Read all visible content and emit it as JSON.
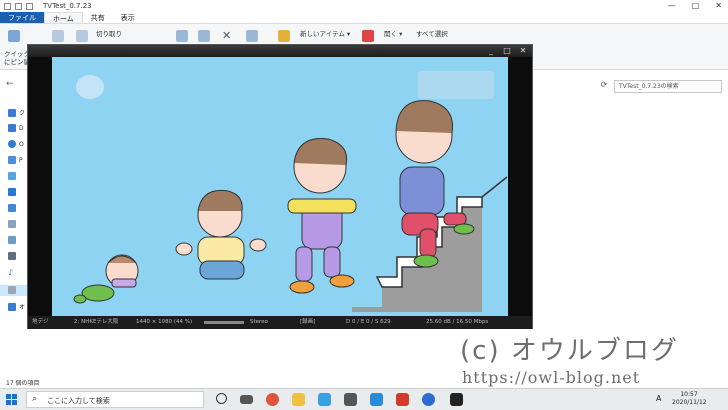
{
  "explorer": {
    "title": "TVTest_0.7.23",
    "window_controls": [
      "—",
      "□",
      "✕"
    ],
    "tabs": [
      {
        "label": "ファイル",
        "style": "file"
      },
      {
        "label": "ホーム",
        "style": "active"
      },
      {
        "label": "共有",
        "style": ""
      },
      {
        "label": "表示",
        "style": ""
      }
    ],
    "ribbon": {
      "cut": "切り取り",
      "quick_access_1": "クイック ア",
      "quick_access_2": "にピン留め",
      "new_item": "新しいアイテム ▾",
      "open": "開く ▾",
      "select_all": "すべて選択"
    },
    "search_placeholder": "TVTest_0.7.23の検索",
    "nav_items": [
      "ク",
      "D",
      "O",
      "P",
      "",
      "",
      "",
      "",
      "",
      "",
      "♪",
      "",
      "オ",
      "C"
    ],
    "status": "17 個の項目"
  },
  "video_window": {
    "window_controls": [
      "_",
      "□",
      "✕"
    ],
    "status": {
      "channel_type": "地デジ",
      "channel": "2: NHKEテレ大阪",
      "resolution": "1440 × 1080 (44 %)",
      "audio": "Stereo",
      "record": "[録画]",
      "drops": "D 0 / E 0 / S 629",
      "signal": "25.60 dB / 16.50 Mbps"
    }
  },
  "watermark": {
    "title": "(c) オウルブログ",
    "url": "https://owl-blog.net"
  },
  "taskbar": {
    "search_text": "ここに入力して検索",
    "time": "10:57",
    "date": "2020/11/12",
    "ime": "A"
  },
  "colors": {
    "video_bg": "#8fd3f2",
    "taskbar_bg": "#e9ecef",
    "ribbon_bg": "#f5f6f7",
    "file_tab": "#1a5fb4"
  }
}
